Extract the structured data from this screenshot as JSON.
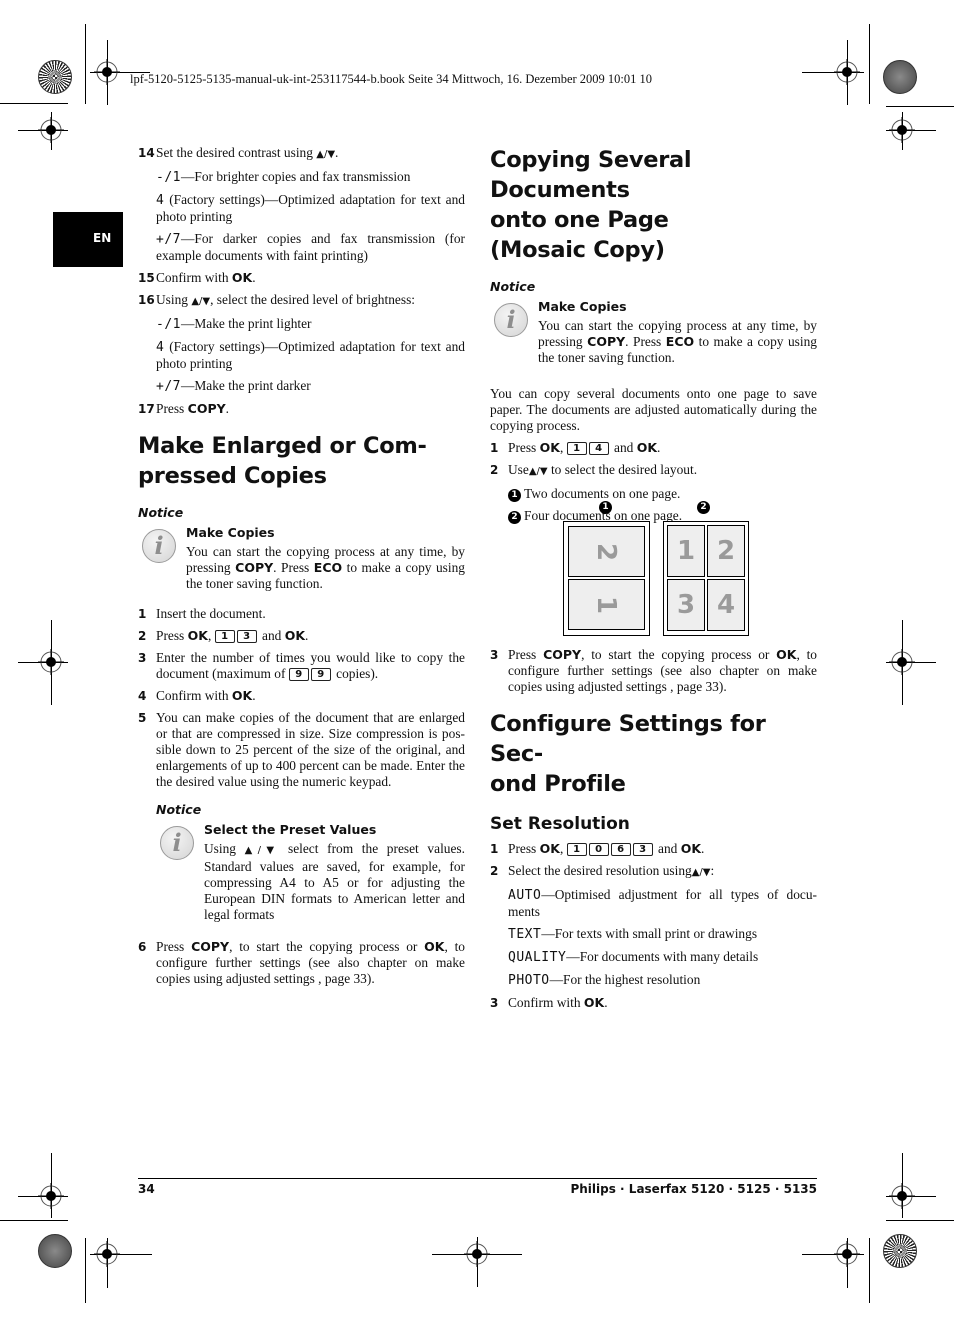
{
  "slug": "lpf-5120-5125-5135-manual-uk-int-253117544-b.book  Seite 34  Mittwoch, 16. Dezember 2009  10:01 10",
  "language_tab": "EN",
  "left_column": {
    "step14": {
      "num": "14",
      "text": "Set the desired contrast using",
      "arrows": "▲/▼",
      "end": "."
    },
    "contrast_options": [
      {
        "key": "-/1",
        "text": "—For brighter copies and fax transmission"
      },
      {
        "key": "4",
        "text": " (Factory settings)—Optimized adaptation for text and photo printing"
      },
      {
        "key": "+/7",
        "text": "—For darker copies and fax transmission (for example documents with faint printing)"
      }
    ],
    "step15": {
      "num": "15",
      "text": "Confirm with",
      "bold": "OK",
      "end": "."
    },
    "step16": {
      "num": "16",
      "pre": "Using",
      "arrows": "▲/▼",
      "text": ", select the desired level of brightness:"
    },
    "brightness_options": [
      {
        "key": "-/1",
        "text": "—Make the print lighter"
      },
      {
        "key": "4",
        "text": " (Factory settings)—Optimized adaptation for text and photo printing"
      },
      {
        "key": "+/7",
        "text": "—Make the print darker"
      }
    ],
    "step17": {
      "num": "17",
      "text": "Press",
      "bold": "COPY",
      "end": "."
    },
    "section_title": "Make Enlarged or Com-pressed Copies",
    "section_title_line1": "Make Enlarged or Com-",
    "section_title_line2": "pressed Copies",
    "notice1": {
      "label": "Notice",
      "title": "Make Copies",
      "pre": "You can start the copying process at any time, by pressing",
      "bold1": "COPY",
      "mid": ". Press",
      "bold2": "ECO",
      "post": "to make a copy using the toner saving function."
    },
    "steps": [
      {
        "num": "1",
        "text": "Insert the document."
      },
      {
        "num": "2",
        "pre": "Press",
        "bold": "OK",
        "keys": [
          "1",
          "3"
        ],
        "and": "and",
        "bold2": "OK",
        "end": "."
      },
      {
        "num": "3",
        "pre": "Enter the number of times you would like to copy the document (maximum of",
        "keys": [
          "9",
          "9"
        ],
        "post": "copies)."
      },
      {
        "num": "4",
        "text": "Confirm with",
        "bold": "OK",
        "end": "."
      },
      {
        "num": "5",
        "text": "You can make copies of the document that are enlarged or that are compressed in size. Size compression is pos-sible down to 25 percent of the size of the original, and enlargements of up to 400 percent can be made.  Enter the the desired value using the numeric keypad."
      }
    ],
    "notice2": {
      "label": "Notice",
      "title": "Select the Preset Values",
      "pre": "Using",
      "arrows": "▲/▼",
      "post": "select from the preset values. Standard values are saved, for example, for compressing A4 to A5 or for adjusting the European DIN formats to American letter and legal formats"
    },
    "step6": {
      "num": "6",
      "pre": "Press",
      "bold1": "COPY",
      "mid": ", to start the copying process or",
      "bold2": "OK",
      "post": ", to configure further settings (see also chapter on  make copies using adjusted settings , page  33)."
    }
  },
  "right_column": {
    "section_title_lines": [
      "Copying Several Documents",
      "onto one Page",
      "(Mosaic Copy)"
    ],
    "notice": {
      "label": "Notice",
      "title": "Make Copies",
      "pre": "You can start the copying process at any time, by pressing",
      "bold1": "COPY",
      "mid": ". Press",
      "bold2": "ECO",
      "post": "to make a copy using the toner saving function."
    },
    "intro": "You can copy several documents onto one page to save paper. The documents are adjusted automatically during the copying process.",
    "step1": {
      "num": "1",
      "pre": "Press",
      "bold": "OK",
      "keys": [
        "1",
        "4"
      ],
      "and": "and",
      "bold2": "OK",
      "end": "."
    },
    "step2": {
      "num": "2",
      "pre": "Use",
      "arrows": "▲/▼",
      "post": "to select the desired layout."
    },
    "layouts": [
      {
        "marker": "1",
        "text": "Two documents on one page."
      },
      {
        "marker": "2",
        "text": "Four documents on one page."
      }
    ],
    "figure": {
      "labels": [
        "1",
        "2"
      ],
      "layout_two": [
        "2",
        "1"
      ],
      "layout_four": [
        "1",
        "2",
        "3",
        "4"
      ]
    },
    "step3": {
      "num": "3",
      "pre": "Press",
      "bold1": "COPY",
      "mid": ", to start the copying process or",
      "bold2": "OK",
      "post": ", to configure further settings (see also chapter on  make copies using adjusted settings , page  33)."
    },
    "section2_title_line1": "Configure Settings for Sec-",
    "section2_title_line2": "ond Profile",
    "subsection_title": "Set Resolution",
    "res_step1": {
      "num": "1",
      "pre": "Press",
      "bold": "OK",
      "keys": [
        "1",
        "0",
        "6",
        "3"
      ],
      "and": "and",
      "bold2": "OK",
      "end": "."
    },
    "res_step2": {
      "num": "2",
      "pre": "Select the desired resolution using",
      "arrows": "▲/▼",
      "end": ":"
    },
    "resolutions": [
      {
        "key": "AUTO",
        "text": "—Optimised adjustment for all types of docu-ments"
      },
      {
        "key": "TEXT",
        "text": "—For texts with small print or drawings"
      },
      {
        "key": "QUALITY",
        "text": "—For documents with many details"
      },
      {
        "key": "PHOTO",
        "text": "—For the highest resolution"
      }
    ],
    "res_step3": {
      "num": "3",
      "text": "Confirm with",
      "bold": "OK",
      "end": "."
    }
  },
  "footer": {
    "page_number": "34",
    "product": "Philips · Laserfax 5120 · 5125 · 5135"
  }
}
